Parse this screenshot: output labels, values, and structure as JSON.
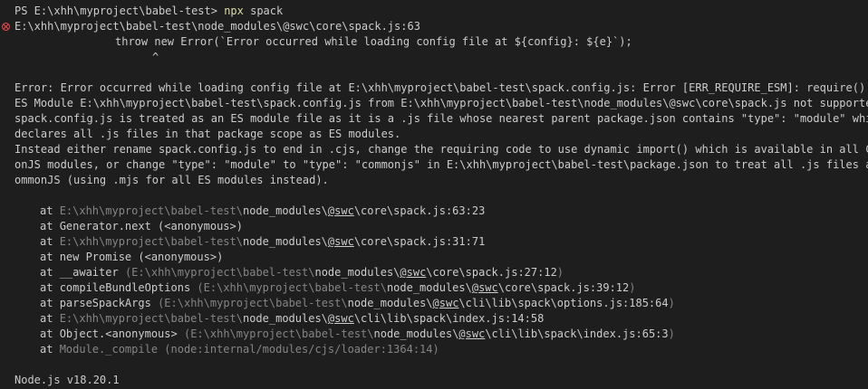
{
  "prompt": {
    "ps": "PS E:\\xhh\\myproject\\babel-test> ",
    "command": "npx",
    "arg": " spack"
  },
  "error_location": "E:\\xhh\\myproject\\babel-test\\node_modules\\@swc\\core\\spack.js:63",
  "code_line": "throw new Error(`Error occurred while loading config file at ${config}: ${e}`);",
  "caret": "^",
  "message_lines": [
    "Error: Error occurred while loading config file at E:\\xhh\\myproject\\babel-test\\spack.config.js: Error [ERR_REQUIRE_ESM]: require() of",
    "ES Module E:\\xhh\\myproject\\babel-test\\spack.config.js from E:\\xhh\\myproject\\babel-test\\node_modules\\@swc\\core\\spack.js not supported.",
    "spack.config.js is treated as an ES module file as it is a .js file whose nearest parent package.json contains \"type\": \"module\" which",
    "declares all .js files in that package scope as ES modules.",
    "Instead either rename spack.config.js to end in .cjs, change the requiring code to use dynamic import() which is available in all Comm",
    "onJS modules, or change \"type\": \"module\" to \"type\": \"commonjs\" in E:\\xhh\\myproject\\babel-test\\package.json to treat all .js files as C",
    "ommonJS (using .mjs for all ES modules instead)."
  ],
  "stack": [
    {
      "pre": "at ",
      "fn": "",
      "open": "",
      "dim": "E:\\xhh\\myproject\\babel-test\\",
      "mid": "node_modules\\",
      "u": "@swc",
      "tail": "\\core\\spack.js:63:23",
      "close": ""
    },
    {
      "pre": "at ",
      "fn": "Generator.next (<anonymous>)",
      "open": "",
      "dim": "",
      "mid": "",
      "u": "",
      "tail": "",
      "close": ""
    },
    {
      "pre": "at ",
      "fn": "",
      "open": "",
      "dim": "E:\\xhh\\myproject\\babel-test\\",
      "mid": "node_modules\\",
      "u": "@swc",
      "tail": "\\core\\spack.js:31:71",
      "close": ""
    },
    {
      "pre": "at ",
      "fn": "new Promise (<anonymous>)",
      "open": "",
      "dim": "",
      "mid": "",
      "u": "",
      "tail": "",
      "close": ""
    },
    {
      "pre": "at ",
      "fn": "__awaiter ",
      "open": "(",
      "dim": "E:\\xhh\\myproject\\babel-test\\",
      "mid": "node_modules\\",
      "u": "@swc",
      "tail": "\\core\\spack.js:27:12",
      "close": ")"
    },
    {
      "pre": "at ",
      "fn": "compileBundleOptions ",
      "open": "(",
      "dim": "E:\\xhh\\myproject\\babel-test\\",
      "mid": "node_modules\\",
      "u": "@swc",
      "tail": "\\core\\spack.js:39:12",
      "close": ")"
    },
    {
      "pre": "at ",
      "fn": "parseSpackArgs ",
      "open": "(",
      "dim": "E:\\xhh\\myproject\\babel-test\\",
      "mid": "node_modules\\",
      "u": "@swc",
      "tail": "\\cli\\lib\\spack\\options.js:185:64",
      "close": ")"
    },
    {
      "pre": "at ",
      "fn": "",
      "open": "",
      "dim": "E:\\xhh\\myproject\\babel-test\\",
      "mid": "node_modules\\",
      "u": "@swc",
      "tail": "\\cli\\lib\\spack\\index.js:14:58",
      "close": ""
    },
    {
      "pre": "at ",
      "fn": "Object.<anonymous> ",
      "open": "(",
      "dim": "E:\\xhh\\myproject\\babel-test\\",
      "mid": "node_modules\\",
      "u": "@swc",
      "tail": "\\cli\\lib\\spack\\index.js:65:3",
      "close": ")"
    },
    {
      "pre": "at ",
      "fn": "",
      "open": "",
      "dim": "Module._compile (node:internal/modules/cjs/loader:1364:14)",
      "mid": "",
      "u": "",
      "tail": "",
      "close": ""
    }
  ],
  "node_version": "Node.js v18.20.1",
  "colors": {
    "background": "#1e1e1e",
    "foreground": "#cccccc",
    "command": "#dcdcaa",
    "dim": "#858585",
    "error_icon": "#f14c4c"
  }
}
